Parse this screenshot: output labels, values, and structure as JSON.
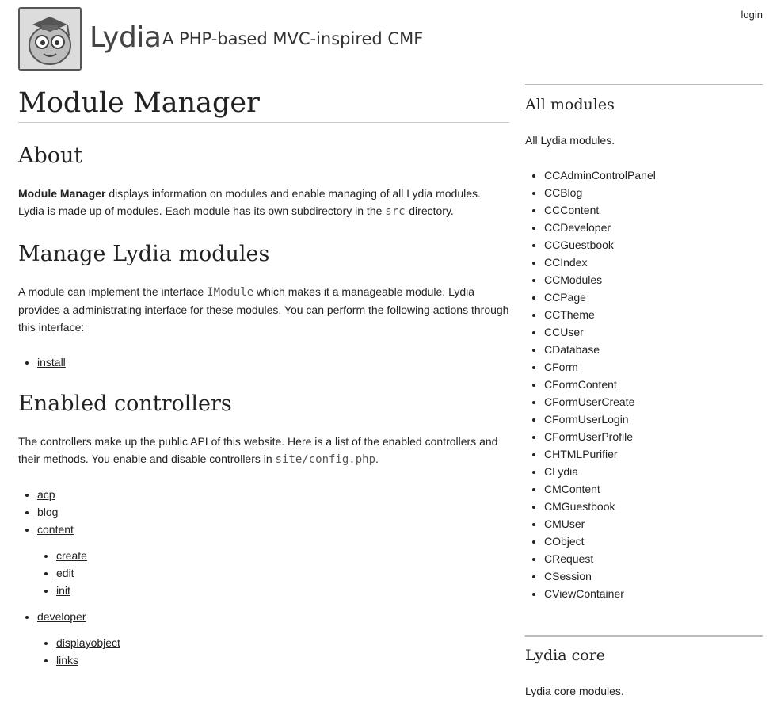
{
  "header": {
    "site_title": "Lydia",
    "slogan": "A PHP-based MVC-inspired CMF",
    "login_label": "login",
    "logo_icon": "owl-logo-icon"
  },
  "main": {
    "page_title": "Module Manager",
    "about": {
      "heading": "About",
      "strong": "Module Manager",
      "text1": " displays information on modules and enable managing of all Lydia modules. Lydia is made up of modules. Each module has its own subdirectory in the ",
      "code": "src",
      "text2": "-directory."
    },
    "manage": {
      "heading": "Manage Lydia modules",
      "text1": "A module can implement the interface ",
      "code": "IModule",
      "text2": " which makes it a manageable module. Lydia provides a administrating interface for these modules. You can perform the following actions through this interface:",
      "actions": [
        "install"
      ]
    },
    "controllers": {
      "heading": "Enabled controllers",
      "text1": "The controllers make up the public API of this website. Here is a list of the enabled controllers and their methods. You enable and disable controllers in ",
      "code": "site/config.php",
      "text2": ".",
      "items": [
        {
          "name": "acp",
          "methods": []
        },
        {
          "name": "blog",
          "methods": []
        },
        {
          "name": "content",
          "methods": [
            "create",
            "edit",
            "init"
          ]
        },
        {
          "name": "developer",
          "methods": [
            "displayobject",
            "links"
          ]
        }
      ]
    }
  },
  "sidebar": {
    "all_modules": {
      "heading": "All modules",
      "description": "All Lydia modules.",
      "items": [
        "CCAdminControlPanel",
        "CCBlog",
        "CCContent",
        "CCDeveloper",
        "CCGuestbook",
        "CCIndex",
        "CCModules",
        "CCPage",
        "CCTheme",
        "CCUser",
        "CDatabase",
        "CForm",
        "CFormContent",
        "CFormUserCreate",
        "CFormUserLogin",
        "CFormUserProfile",
        "CHTMLPurifier",
        "CLydia",
        "CMContent",
        "CMGuestbook",
        "CMUser",
        "CObject",
        "CRequest",
        "CSession",
        "CViewContainer"
      ]
    },
    "core": {
      "heading": "Lydia core",
      "description": "Lydia core modules."
    }
  }
}
